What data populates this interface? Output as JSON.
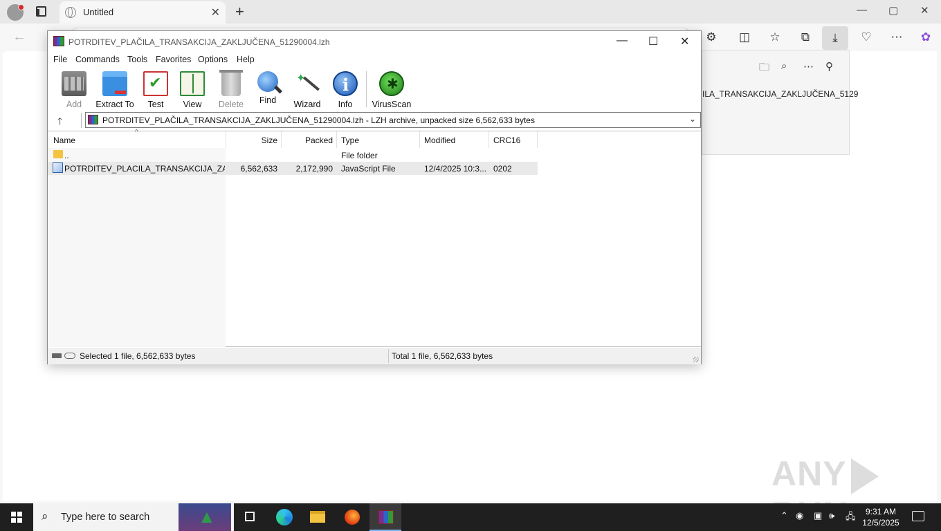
{
  "browser": {
    "tab_title": "Untitled",
    "tab_close": "✕",
    "new_tab": "+",
    "minimize": "—",
    "maximize": "▢",
    "close": "✕",
    "back": "←",
    "toolbar_icons": [
      "extensions-icon",
      "split-screen-icon",
      "favorites-icon",
      "collections-icon",
      "downloads-icon",
      "browser-essentials-icon",
      "more-icon",
      "copilot-icon"
    ],
    "downloads_panel": {
      "file_label": "ILA_TRANSAKCIJA_ZAKLJUČENA_5129",
      "icons": [
        "folder-icon",
        "search-icon",
        "more-icon",
        "pin-icon"
      ]
    }
  },
  "watermark": {
    "left": "ANY",
    "right": "RUN"
  },
  "winrar": {
    "title": "POTRDITEV_PLAČILA_TRANSAKCIJA_ZAKLJUČENA_51290004.lzh",
    "menu": [
      "File",
      "Commands",
      "Tools",
      "Favorites",
      "Options",
      "Help"
    ],
    "toolbar": [
      {
        "label": "Add",
        "icon": "add-archive-icon",
        "enabled": false
      },
      {
        "label": "Extract To",
        "icon": "extract-to-icon",
        "enabled": true
      },
      {
        "label": "Test",
        "icon": "test-icon",
        "enabled": true
      },
      {
        "label": "View",
        "icon": "view-icon",
        "enabled": true
      },
      {
        "label": "Delete",
        "icon": "delete-icon",
        "enabled": false
      },
      {
        "label": "Find",
        "icon": "find-icon",
        "enabled": true
      },
      {
        "label": "Wizard",
        "icon": "wizard-icon",
        "enabled": true
      },
      {
        "label": "Info",
        "icon": "info-icon",
        "enabled": true
      },
      {
        "label": "VirusScan",
        "icon": "virusscan-icon",
        "enabled": true
      }
    ],
    "path": "POTRDITEV_PLAČILA_TRANSAKCIJA_ZAKLJUČENA_51290004.lzh - LZH archive, unpacked size 6,562,633 bytes",
    "columns": [
      "Name",
      "Size",
      "Packed",
      "Type",
      "Modified",
      "CRC16"
    ],
    "rows": [
      {
        "name": "..",
        "size": "",
        "packed": "",
        "type": "File folder",
        "modified": "",
        "crc": "",
        "icon": "folder-icon"
      },
      {
        "name": "POTRDITEV_PLACILA_TRANSAKCIJA_ZAKL...",
        "size": "6,562,633",
        "packed": "2,172,990",
        "type": "JavaScript File",
        "modified": "12/4/2025 10:3...",
        "crc": "0202",
        "icon": "javascript-file-icon"
      }
    ],
    "status_left": "Selected 1 file, 6,562,633 bytes",
    "status_right": "Total 1 file, 6,562,633 bytes"
  },
  "taskbar": {
    "search_placeholder": "Type here to search",
    "apps": [
      "task-view-icon",
      "edge-icon",
      "file-explorer-icon",
      "firefox-icon",
      "winrar-icon"
    ],
    "clock_time": "9:31 AM",
    "clock_date": "12/5/2025"
  }
}
